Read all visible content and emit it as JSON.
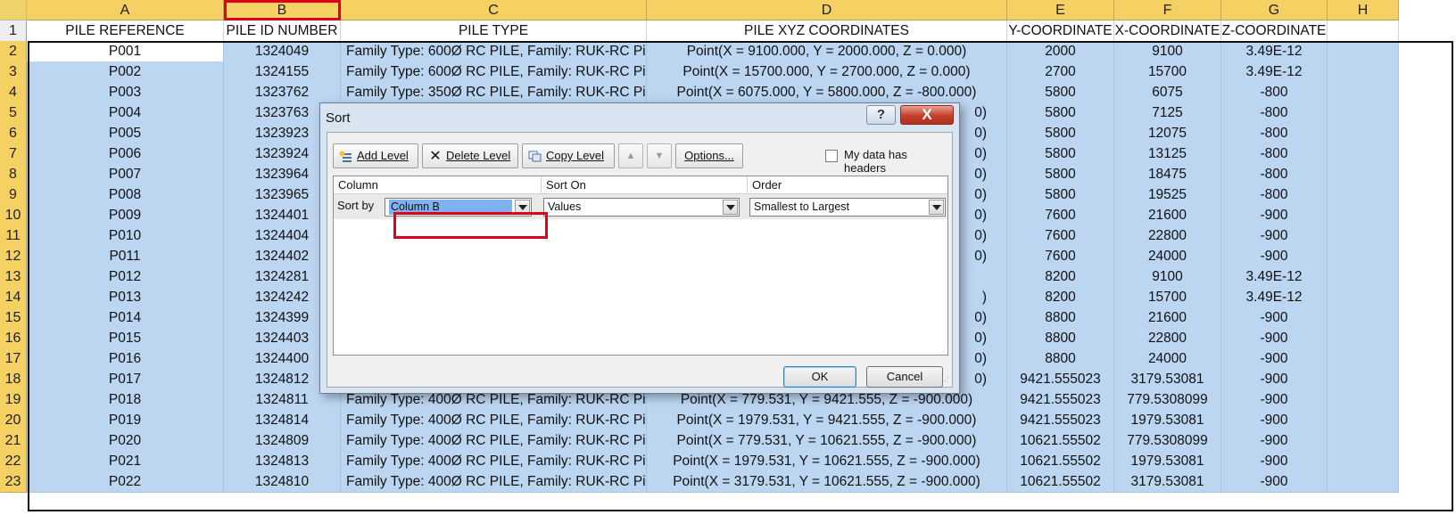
{
  "columns": [
    {
      "letter": "A",
      "header": "PILE REFERENCE"
    },
    {
      "letter": "B",
      "header": "PILE ID NUMBER"
    },
    {
      "letter": "C",
      "header": "PILE TYPE"
    },
    {
      "letter": "D",
      "header": "PILE XYZ COORDINATES"
    },
    {
      "letter": "E",
      "header": "Y-COORDINATE"
    },
    {
      "letter": "F",
      "header": "X-COORDINATE"
    },
    {
      "letter": "G",
      "header": "Z-COORDINATE"
    },
    {
      "letter": "H",
      "header": ""
    }
  ],
  "rows": [
    {
      "n": "2",
      "a": "P001",
      "b": "1324049",
      "c": "Family Type: 600Ø RC PILE, Family: RUK-RC Pile",
      "d": "Point(X = 9100.000, Y = 2000.000, Z = 0.000)",
      "e": "2000",
      "f": "9100",
      "g": "3.49E-12"
    },
    {
      "n": "3",
      "a": "P002",
      "b": "1324155",
      "c": "Family Type: 600Ø RC PILE, Family: RUK-RC Pile",
      "d": "Point(X = 15700.000, Y = 2700.000, Z = 0.000)",
      "e": "2700",
      "f": "15700",
      "g": "3.49E-12"
    },
    {
      "n": "4",
      "a": "P003",
      "b": "1323762",
      "c": "Family Type: 350Ø RC PILE, Family: RUK-RC Pile",
      "d": "Point(X = 6075.000, Y = 5800.000, Z = -800.000)",
      "e": "5800",
      "f": "6075",
      "g": "-800"
    },
    {
      "n": "5",
      "a": "P004",
      "b": "1323763",
      "c": "",
      "d": "0)",
      "e": "5800",
      "f": "7125",
      "g": "-800"
    },
    {
      "n": "6",
      "a": "P005",
      "b": "1323923",
      "c": "",
      "d": "0)",
      "e": "5800",
      "f": "12075",
      "g": "-800"
    },
    {
      "n": "7",
      "a": "P006",
      "b": "1323924",
      "c": "",
      "d": "0)",
      "e": "5800",
      "f": "13125",
      "g": "-800"
    },
    {
      "n": "8",
      "a": "P007",
      "b": "1323964",
      "c": "",
      "d": "0)",
      "e": "5800",
      "f": "18475",
      "g": "-800"
    },
    {
      "n": "9",
      "a": "P008",
      "b": "1323965",
      "c": "",
      "d": "0)",
      "e": "5800",
      "f": "19525",
      "g": "-800"
    },
    {
      "n": "10",
      "a": "P009",
      "b": "1324401",
      "c": "",
      "d": "0)",
      "e": "7600",
      "f": "21600",
      "g": "-900"
    },
    {
      "n": "11",
      "a": "P010",
      "b": "1324404",
      "c": "",
      "d": "0)",
      "e": "7600",
      "f": "22800",
      "g": "-900"
    },
    {
      "n": "12",
      "a": "P011",
      "b": "1324402",
      "c": "",
      "d": "0)",
      "e": "7600",
      "f": "24000",
      "g": "-900"
    },
    {
      "n": "13",
      "a": "P012",
      "b": "1324281",
      "c": "",
      "d": "",
      "e": "8200",
      "f": "9100",
      "g": "3.49E-12"
    },
    {
      "n": "14",
      "a": "P013",
      "b": "1324242",
      "c": "",
      "d": ")",
      "e": "8200",
      "f": "15700",
      "g": "3.49E-12"
    },
    {
      "n": "15",
      "a": "P014",
      "b": "1324399",
      "c": "",
      "d": "0)",
      "e": "8800",
      "f": "21600",
      "g": "-900"
    },
    {
      "n": "16",
      "a": "P015",
      "b": "1324403",
      "c": "",
      "d": "0)",
      "e": "8800",
      "f": "22800",
      "g": "-900"
    },
    {
      "n": "17",
      "a": "P016",
      "b": "1324400",
      "c": "",
      "d": "0)",
      "e": "8800",
      "f": "24000",
      "g": "-900"
    },
    {
      "n": "18",
      "a": "P017",
      "b": "1324812",
      "c": "",
      "d": "0)",
      "e": "9421.555023",
      "f": "3179.53081",
      "g": "-900"
    },
    {
      "n": "19",
      "a": "P018",
      "b": "1324811",
      "c": "Family Type: 400Ø RC PILE, Family: RUK-RC Pile",
      "d": "Point(X = 779.531, Y = 9421.555, Z = -900.000)",
      "e": "9421.555023",
      "f": "779.5308099",
      "g": "-900"
    },
    {
      "n": "20",
      "a": "P019",
      "b": "1324814",
      "c": "Family Type: 400Ø RC PILE, Family: RUK-RC Pile",
      "d": "Point(X = 1979.531, Y = 9421.555, Z = -900.000)",
      "e": "9421.555023",
      "f": "1979.53081",
      "g": "-900"
    },
    {
      "n": "21",
      "a": "P020",
      "b": "1324809",
      "c": "Family Type: 400Ø RC PILE, Family: RUK-RC Pile",
      "d": "Point(X = 779.531, Y = 10621.555, Z = -900.000)",
      "e": "10621.55502",
      "f": "779.5308099",
      "g": "-900"
    },
    {
      "n": "22",
      "a": "P021",
      "b": "1324813",
      "c": "Family Type: 400Ø RC PILE, Family: RUK-RC Pile",
      "d": "Point(X = 1979.531, Y = 10621.555, Z = -900.000)",
      "e": "10621.55502",
      "f": "1979.53081",
      "g": "-900"
    },
    {
      "n": "23",
      "a": "P022",
      "b": "1324810",
      "c": "Family Type: 400Ø RC PILE, Family: RUK-RC Pile",
      "d": "Point(X = 3179.531, Y = 10621.555, Z = -900.000)",
      "e": "10621.55502",
      "f": "3179.53081",
      "g": "-900"
    }
  ],
  "dialog": {
    "title": "Sort",
    "help_label": "?",
    "close_label": "X",
    "toolbar": {
      "add_level": "Add Level",
      "delete_level": "Delete Level",
      "copy_level": "Copy Level",
      "move_up": "▲",
      "move_down": "▼",
      "options": "Options..."
    },
    "my_data_has_headers": "My data has headers",
    "headers_checked": false,
    "grid_headers": {
      "column": "Column",
      "sort_on": "Sort On",
      "order": "Order"
    },
    "sort_by_label": "Sort by",
    "column_value": "Column B",
    "sort_on_value": "Values",
    "order_value": "Smallest to Largest",
    "ok_label": "OK",
    "cancel_label": "Cancel"
  },
  "colors": {
    "header_fill": "#f5d063",
    "selection_fill": "#bcd6f2",
    "highlight_red": "#e0001a",
    "dialog_frame": "#d9e4f1"
  },
  "icons": {
    "add_level": "add-level-icon",
    "delete_level": "delete-x-icon",
    "copy_level": "copy-icon"
  }
}
